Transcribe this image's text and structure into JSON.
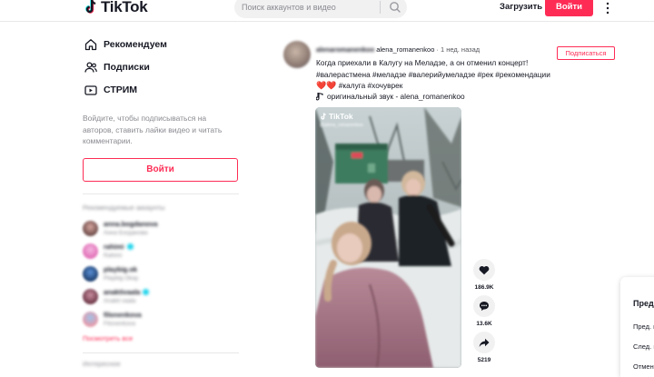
{
  "header": {
    "logo_text": "TikTok",
    "search_placeholder": "Поиск аккаунтов и видео",
    "upload_label": "Загрузить",
    "login_label": "Войти"
  },
  "sidebar": {
    "nav": [
      {
        "label": "Рекомендуем",
        "icon": "home-icon"
      },
      {
        "label": "Подписки",
        "icon": "following-icon"
      },
      {
        "label": "СТРИМ",
        "icon": "live-icon"
      }
    ],
    "hint": "Войдите, чтобы подписываться на авторов, ставить лайки видео и читать комментарии.",
    "login_label": "Войти",
    "recommended_title": "Рекомендуемые аккаунты",
    "accounts": [
      {
        "name": "anna.bogdanova",
        "sub": "Анна Богданова",
        "verified": false
      },
      {
        "name": "rahimi",
        "sub": "Rahimi",
        "verified": true
      },
      {
        "name": "playbig.ok",
        "sub": "Playbig Okay",
        "verified": false
      },
      {
        "name": "anaktivaala",
        "sub": "Anakti vaala",
        "verified": true
      },
      {
        "name": "filonenkova",
        "sub": "Filonenkova",
        "verified": false
      }
    ],
    "see_all": "Посмотреть все",
    "interests_title": "Интересное"
  },
  "post": {
    "author_blurred": "alenaromanenkoo",
    "author_handle": "alena_romanenkoo",
    "time": "· 1 нед. назад",
    "follow_label": "Подписаться",
    "caption_line1": "Когда приехали в Калугу на Меладзе, а он отменил концерт!",
    "caption_line2": "#валерастмена #меладзе #валерийумеладзе #рек #рекомендации",
    "hearts": "❤️❤️",
    "caption_line3": "#калуга #хочуврек",
    "sound_label": "оригинальный звук - alena_romanenkoo",
    "video_logo": "TikTok",
    "video_handle": "@alena_romanenkoo",
    "likes": "186.9K",
    "comments": "13.6K",
    "shares": "5219"
  },
  "side_panel": {
    "title": "Пред",
    "row1": "Пред. в",
    "row2": "След. в",
    "row3": "Отмени"
  },
  "colors": {
    "brand": "#fe2c55",
    "text": "#161823",
    "muted": "#8a8b91"
  }
}
